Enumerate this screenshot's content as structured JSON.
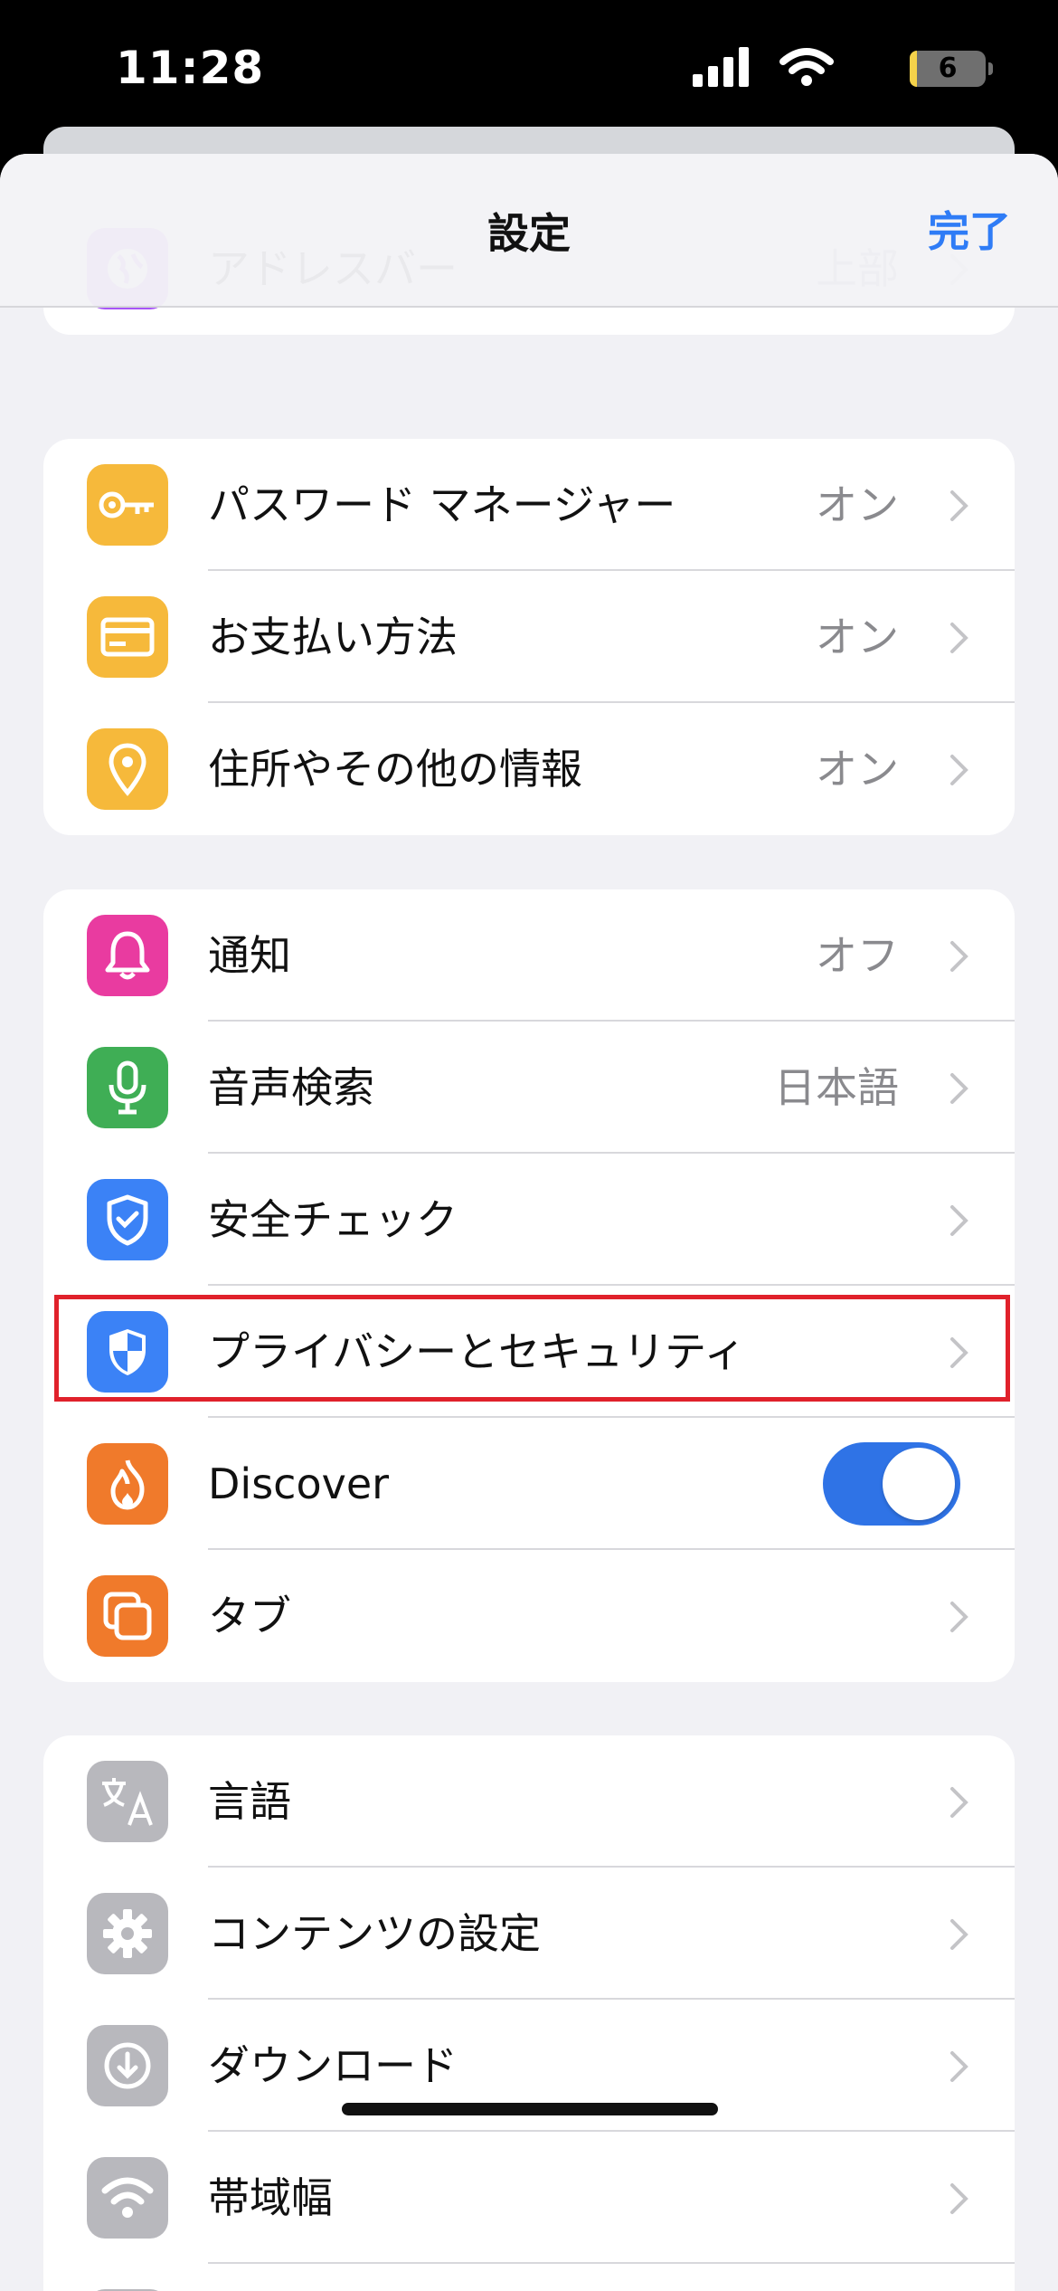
{
  "status": {
    "time": "11:28",
    "battery": "6"
  },
  "nav": {
    "title": "設定",
    "done": "完了"
  },
  "groups": [
    [
      {
        "label": "アドレスバー",
        "value": "上部",
        "icon": "globe-icon",
        "color": "#a855f7"
      }
    ],
    [
      {
        "label": "パスワード マネージャー",
        "value": "オン",
        "icon": "key-icon",
        "color": "#f6b93b"
      },
      {
        "label": "お支払い方法",
        "value": "オン",
        "icon": "credit-card-icon",
        "color": "#f6b93b"
      },
      {
        "label": "住所やその他の情報",
        "value": "オン",
        "icon": "location-pin-icon",
        "color": "#f6b93b"
      }
    ],
    [
      {
        "label": "通知",
        "value": "オフ",
        "icon": "bell-icon",
        "color": "#e93ba0"
      },
      {
        "label": "音声検索",
        "value": "日本語",
        "icon": "microphone-icon",
        "color": "#3fae55"
      },
      {
        "label": "安全チェック",
        "value": "",
        "icon": "shield-check-icon",
        "color": "#3b82f6"
      },
      {
        "label": "プライバシーとセキュリティ",
        "value": "",
        "icon": "shield-half-icon",
        "color": "#3b82f6"
      },
      {
        "label": "Discover",
        "value": "",
        "icon": "flame-icon",
        "color": "#f07a2b",
        "toggle": true
      },
      {
        "label": "タブ",
        "value": "",
        "icon": "tabs-icon",
        "color": "#f07a2b"
      }
    ],
    [
      {
        "label": "言語",
        "value": "",
        "icon": "translate-icon",
        "color": "#b8b8bd"
      },
      {
        "label": "コンテンツの設定",
        "value": "",
        "icon": "gear-icon",
        "color": "#b8b8bd"
      },
      {
        "label": "ダウンロード",
        "value": "",
        "icon": "download-icon",
        "color": "#b8b8bd"
      },
      {
        "label": "帯域幅",
        "value": "",
        "icon": "wifi-icon",
        "color": "#b8b8bd"
      }
    ]
  ]
}
